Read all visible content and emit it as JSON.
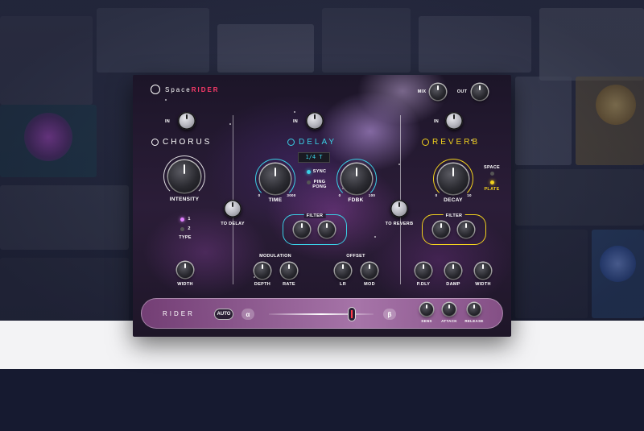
{
  "brand": {
    "name_part1": "Space",
    "name_part2": "RIDER"
  },
  "global": {
    "mix_label": "MIX",
    "out_label": "OUT"
  },
  "chorus": {
    "in_label": "IN",
    "title": "CHORUS",
    "intensity_label": "INTENSITY",
    "type_label": "TYPE",
    "type_options": [
      "1",
      "2"
    ],
    "width_label": "WIDTH",
    "to_delay_label": "TO DELAY",
    "accent": "#ffffff"
  },
  "delay": {
    "in_label": "IN",
    "title": "DELAY",
    "display_value": "1/4 T",
    "time_label": "TIME",
    "time_min": "0",
    "time_max": "3000",
    "fdbk_label": "FDBK",
    "fdbk_min": "0",
    "fdbk_max": "100",
    "sync_label": "SYNC",
    "ping_pong_label": "PING\nPONG",
    "filter_label": "FILTER",
    "modulation_label": "MODULATION",
    "offset_label": "OFFSET",
    "depth_label": "DEPTH",
    "rate_label": "RATE",
    "lr_label": "LR",
    "mod_label": "MOD",
    "to_reverb_label": "TO REVERB",
    "accent": "#3ad0e6"
  },
  "reverb": {
    "in_label": "IN",
    "title": "REVERB",
    "decay_label": "DECAY",
    "decay_min": "0",
    "decay_max": "10",
    "space_label": "SPACE",
    "plate_label": "PLATE",
    "filter_label": "FILTER",
    "pdly_label": "P.DLY",
    "damp_label": "DAMP",
    "width_label": "WIDTH",
    "accent": "#f2d21e"
  },
  "rider": {
    "title": "RIDER",
    "auto_label": "AUTO",
    "alpha_label": "α",
    "beta_label": "β",
    "sens_label": "SENS",
    "attack_label": "ATTACK",
    "release_label": "RELEASE"
  }
}
